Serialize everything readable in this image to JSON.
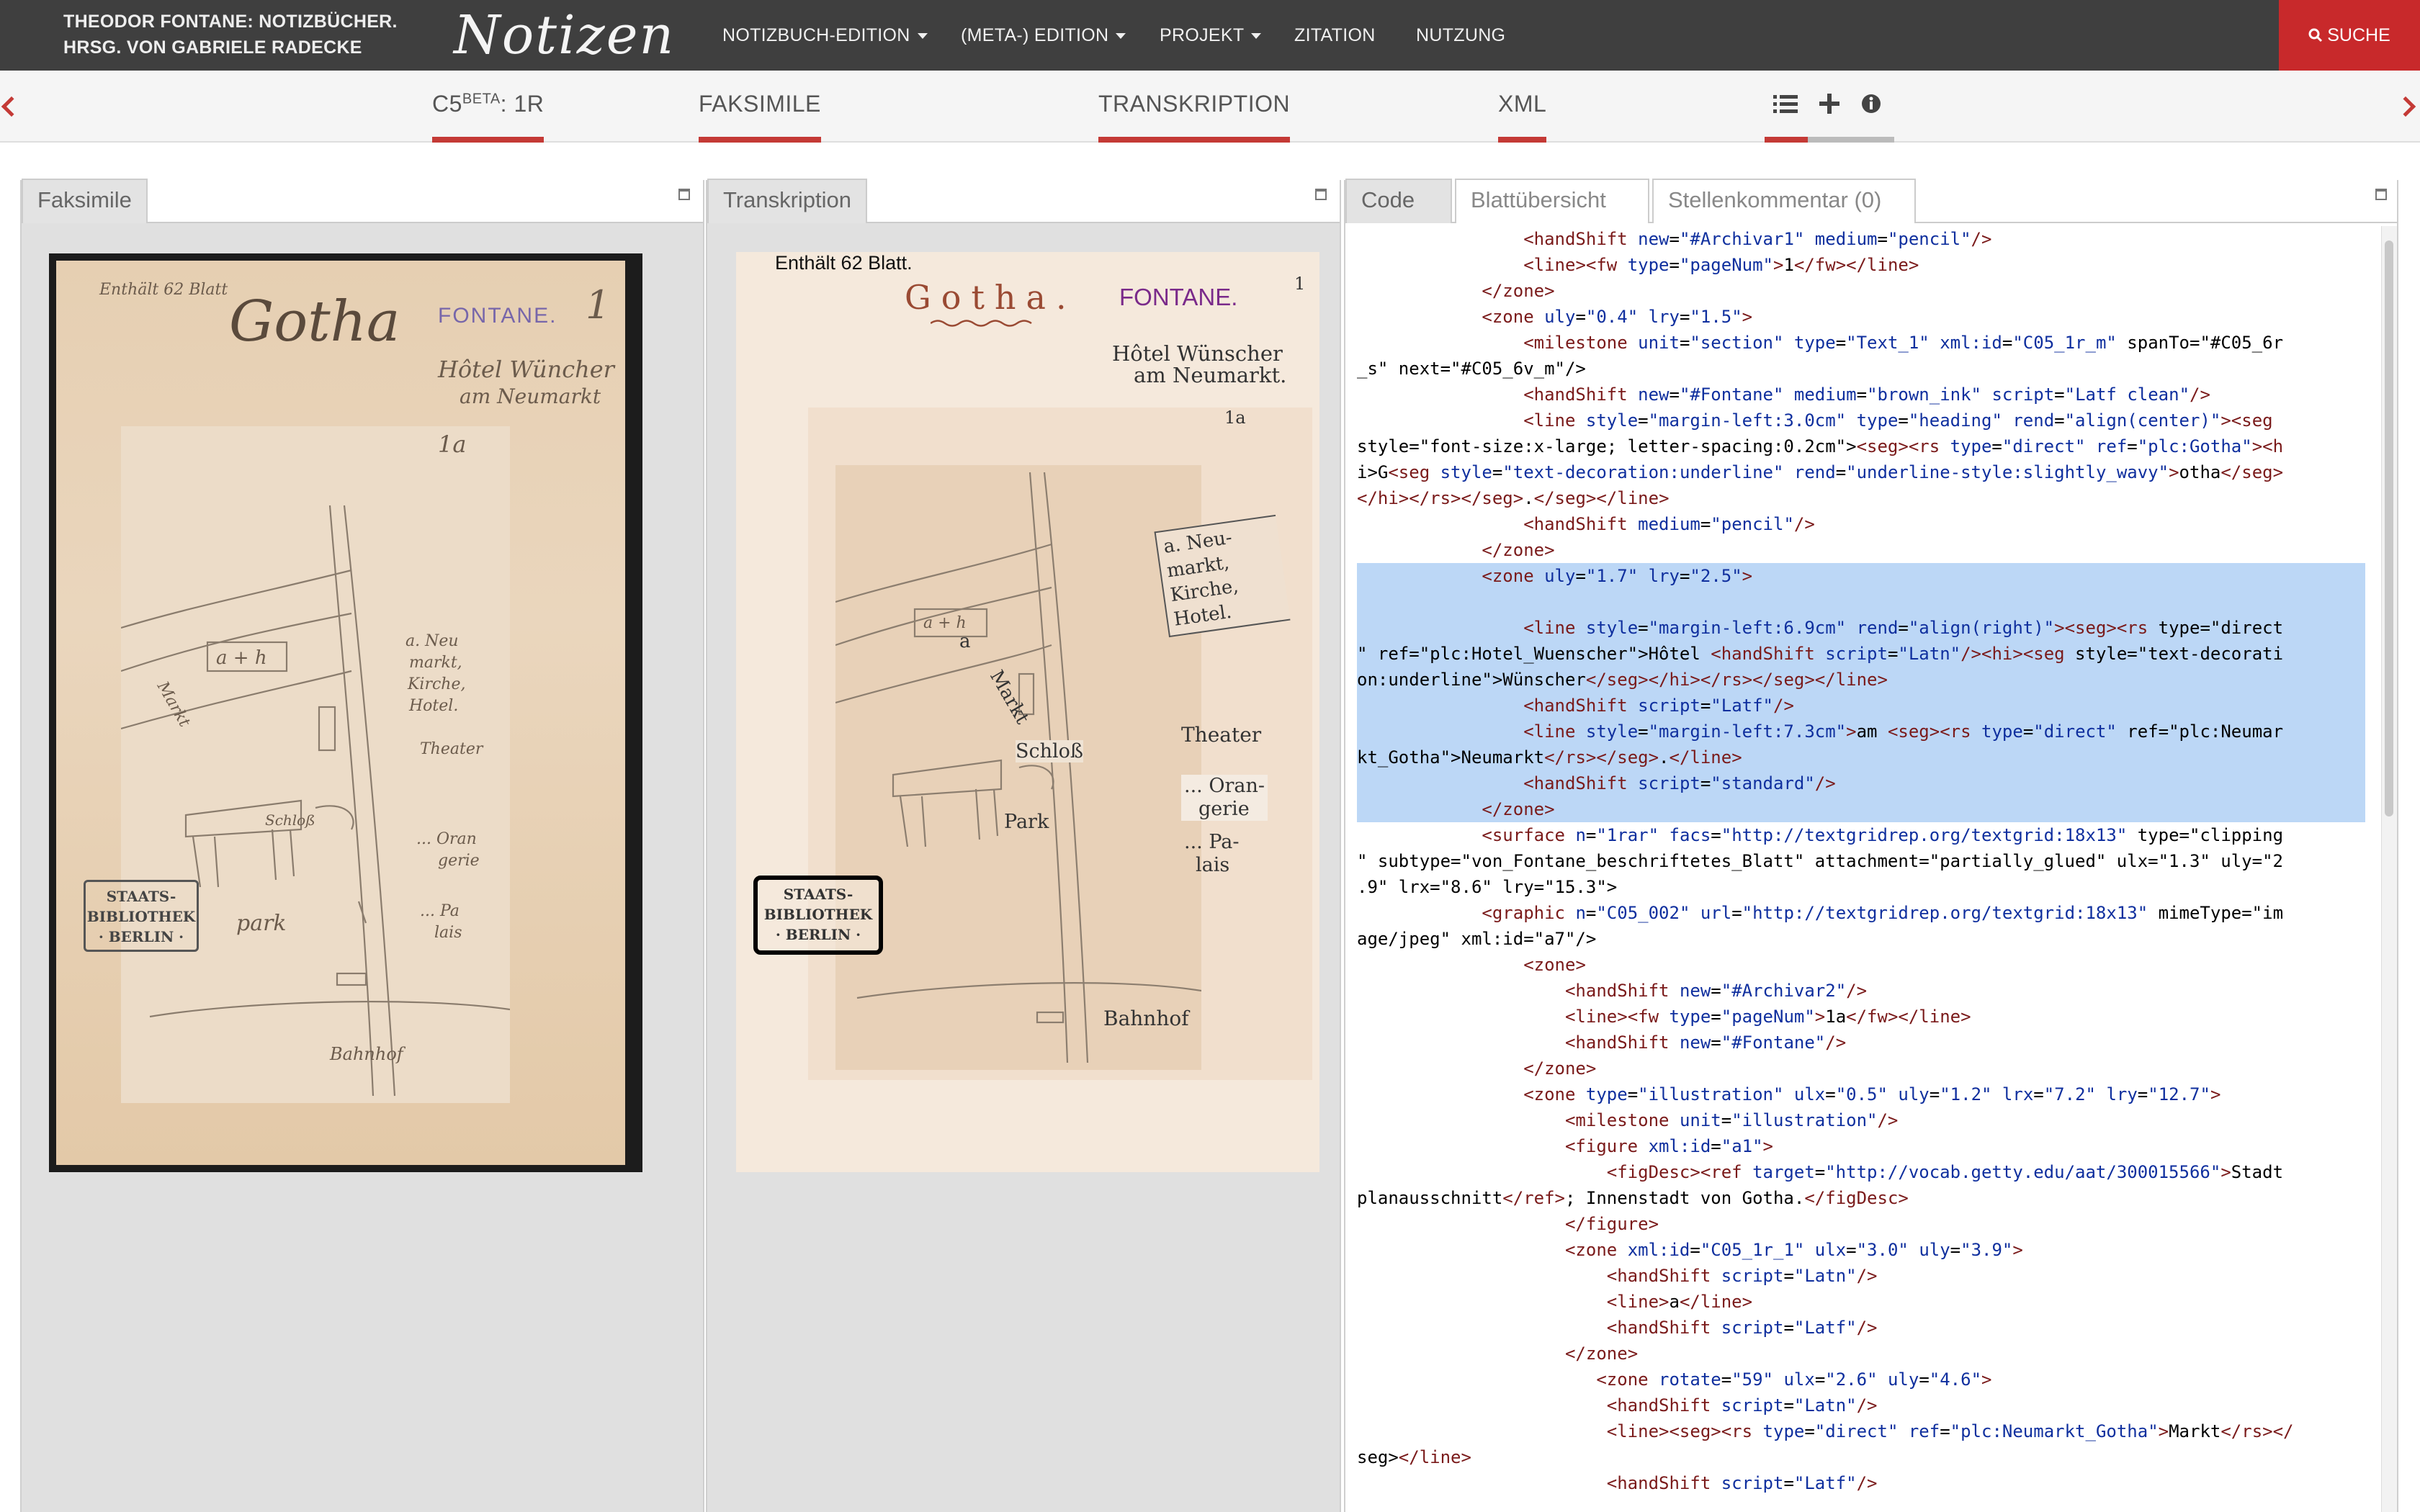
{
  "header": {
    "brand_line1": "THEODOR FONTANE: NOTIZBÜCHER.",
    "brand_line2": "HRSG. VON GABRIELE RADECKE",
    "logo": "Notizen",
    "nav": [
      "NOTIZBUCH-EDITION",
      "(META-) EDITION",
      "PROJEKT",
      "ZITATION",
      "NUTZUNG"
    ],
    "search_label": "SUCHE"
  },
  "subbar": {
    "page_id": "C5",
    "page_sup": "BETA",
    "page_suffix": ": 1R",
    "tabs": [
      "FAKSIMILE",
      "TRANSKRIPTION",
      "XML"
    ]
  },
  "facsimile_panel": {
    "tab": "Faksimile",
    "pencil_notes": {
      "blatt": "Enthält 62 Blatt",
      "gotha": "Gotha",
      "fontane": "FONTANE.",
      "num": "1",
      "hotel": "Hôtel Wüncher",
      "am": "am Neumarkt",
      "one_a": "1a"
    },
    "stamp": [
      "STAATS-",
      "BIBLIOTHEK",
      "· BERLIN ·"
    ]
  },
  "transcription_panel": {
    "tab": "Transkription",
    "blatt": "Enthält 62 Blatt.",
    "gotha": "Gotha.",
    "fontane": "FONTANE.",
    "num": "1",
    "hotel1": "Hôtel Wünscher",
    "hotel2": "am Neumarkt.",
    "one_a": "1a",
    "a_neumarkt": [
      "a. Neu-",
      "markt,",
      "Kirche,",
      "Hotel."
    ],
    "theater": "Theater",
    "markt": "Markt",
    "a": "a",
    "schloss": "Schloß",
    "orangerie": [
      "... Oran-",
      "gerie"
    ],
    "park": "Park",
    "palais": [
      "... Pa-",
      "lais"
    ],
    "bahnhof": "Bahnhof",
    "stamp": [
      "STAATS-",
      "BIBLIOTHEK",
      "· BERLIN ·"
    ]
  },
  "code_panel": {
    "tabs": [
      "Code",
      "Blattübersicht",
      "Stellenkommentar (0)"
    ],
    "lines": [
      "                <handShift new=\"#Archivar1\" medium=\"pencil\"/>",
      "                <line><fw type=\"pageNum\">1</fw></line>",
      "            </zone>",
      "            <zone uly=\"0.4\" lry=\"1.5\">",
      "                <milestone unit=\"section\" type=\"Text_1\" xml:id=\"C05_1r_m\" spanTo=\"#C05_6r",
      "_s\" next=\"#C05_6v_m\"/>",
      "                <handShift new=\"#Fontane\" medium=\"brown_ink\" script=\"Latf clean\"/>",
      "                <line style=\"margin-left:3.0cm\" type=\"heading\" rend=\"align(center)\"><seg",
      "style=\"font-size:x-large; letter-spacing:0.2cm\"><seg><rs type=\"direct\" ref=\"plc:Gotha\"><h",
      "i>G<seg style=\"text-decoration:underline\" rend=\"underline-style:slightly_wavy\">otha</seg>",
      "</hi></rs></seg>.</seg></line>",
      "                <handShift medium=\"pencil\"/>",
      "            </zone>",
      "            <zone uly=\"1.7\" lry=\"2.5\">",
      "",
      "                <line style=\"margin-left:6.9cm\" rend=\"align(right)\"><seg><rs type=\"direct",
      "\" ref=\"plc:Hotel_Wuenscher\">Hôtel <handShift script=\"Latn\"/><hi><seg style=\"text-decorati",
      "on:underline\">Wünscher</seg></hi></rs></seg></line>",
      "                <handShift script=\"Latf\"/>",
      "                <line style=\"margin-left:7.3cm\">am <seg><rs type=\"direct\" ref=\"plc:Neumar",
      "kt_Gotha\">Neumarkt</rs></seg>.</line>",
      "                <handShift script=\"standard\"/>",
      "            </zone>",
      "            <surface n=\"1rar\" facs=\"http://textgridrep.org/textgrid:18x13\" type=\"clipping",
      "\" subtype=\"von_Fontane_beschriftetes_Blatt\" attachment=\"partially_glued\" ulx=\"1.3\" uly=\"2",
      ".9\" lrx=\"8.6\" lry=\"15.3\">",
      "            <graphic n=\"C05_002\" url=\"http://textgridrep.org/textgrid:18x13\" mimeType=\"im",
      "age/jpeg\" xml:id=\"a7\"/>",
      "                <zone>",
      "                    <handShift new=\"#Archivar2\"/>",
      "                    <line><fw type=\"pageNum\">1a</fw></line>",
      "                    <handShift new=\"#Fontane\"/>",
      "                </zone>",
      "                <zone type=\"illustration\" ulx=\"0.5\" uly=\"1.2\" lrx=\"7.2\" lry=\"12.7\">",
      "                    <milestone unit=\"illustration\"/>",
      "                    <figure xml:id=\"a1\">",
      "                        <figDesc><ref target=\"http://vocab.getty.edu/aat/300015566\">Stadt",
      "planausschnitt</ref>; Innenstadt von Gotha.</figDesc>",
      "                    </figure>",
      "                    <zone xml:id=\"C05_1r_1\" ulx=\"3.0\" uly=\"3.9\">",
      "                        <handShift script=\"Latn\"/>",
      "                        <line>a</line>",
      "                        <handShift script=\"Latf\"/>",
      "                    </zone>",
      "                       <zone rotate=\"59\" ulx=\"2.6\" uly=\"4.6\">",
      "                        <handShift script=\"Latn\"/>",
      "                        <line><seg><rs type=\"direct\" ref=\"plc:Neumarkt_Gotha\">Markt</rs></",
      "seg></line>",
      "                        <handShift script=\"Latf\"/>"
    ],
    "highlight_from": 13,
    "highlight_to": 22
  }
}
